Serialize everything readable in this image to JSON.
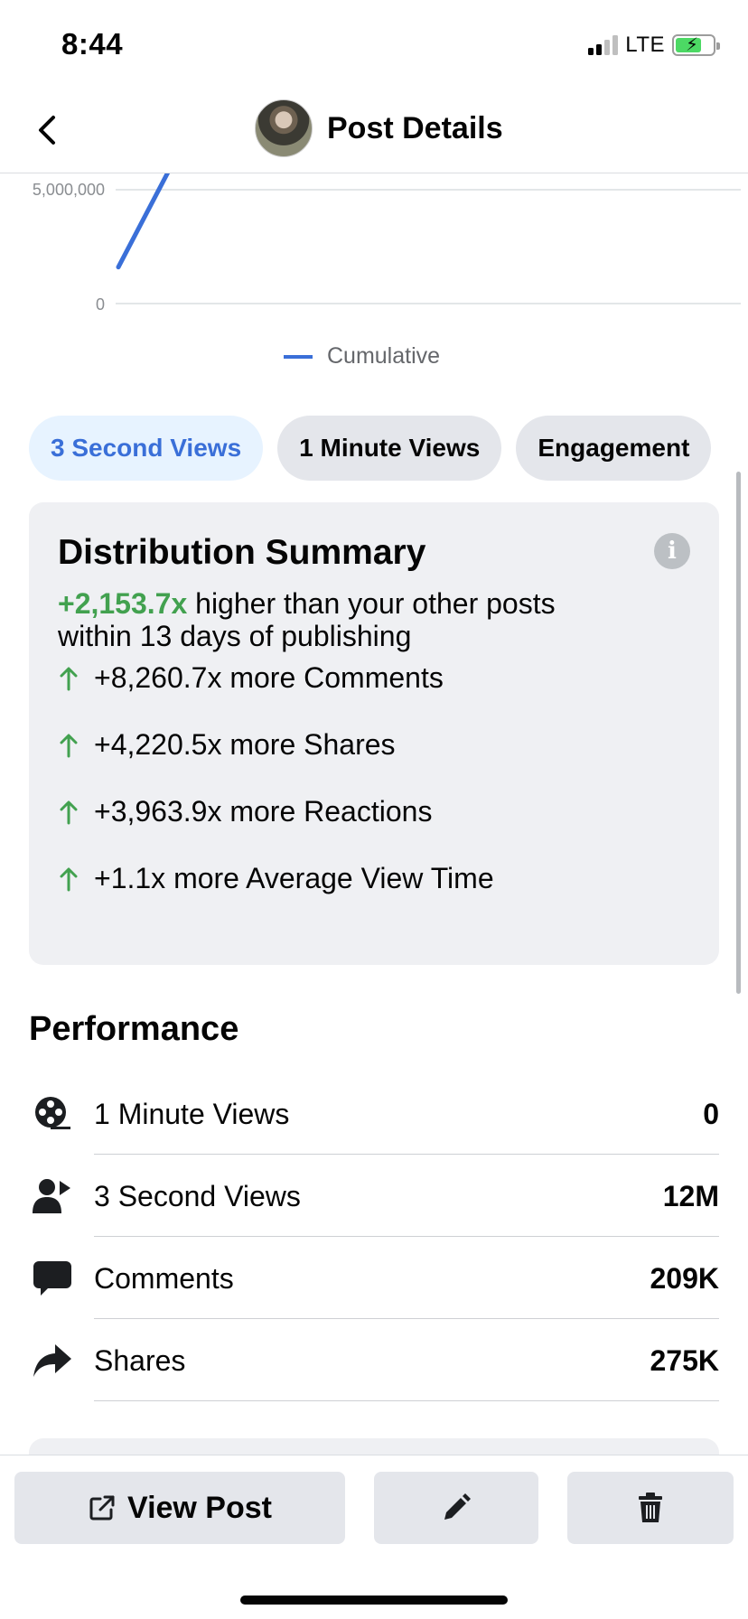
{
  "status_bar": {
    "time": "8:44",
    "network": "LTE",
    "signal_bars_active": 2,
    "signal_bars_total": 4,
    "battery_level": 0.7,
    "battery_charging": true,
    "battery_color": "#4cd964"
  },
  "header": {
    "title": "Post Details",
    "back_icon": "chevron-left-icon"
  },
  "chart_data": {
    "type": "line",
    "y_ticks": [
      "5,000,000",
      "0"
    ],
    "ylim": [
      0,
      5000000
    ],
    "series": [
      {
        "name": "Cumulative",
        "color": "#3a6fd8",
        "values": [
          1600000,
          6000000
        ]
      }
    ],
    "legend": "bottom-center"
  },
  "tabs": [
    {
      "label": "3 Second Views",
      "active": true
    },
    {
      "label": "1 Minute Views",
      "active": false
    },
    {
      "label": "Engagement",
      "active": false
    }
  ],
  "summary": {
    "title": "Distribution Summary",
    "info_icon": "info-icon",
    "highlight": "+2,153.7x",
    "lead_line1": " higher than your other posts",
    "lead_line2": "within 13 days of publishing",
    "highlight_color": "#42a14f",
    "metrics": [
      {
        "text": "+8,260.7x more Comments"
      },
      {
        "text": "+4,220.5x more Shares"
      },
      {
        "text": "+3,963.9x more Reactions"
      },
      {
        "text": "+1.1x more Average View Time"
      }
    ]
  },
  "performance": {
    "title": "Performance",
    "rows": [
      {
        "label": "1 Minute Views",
        "value": "0",
        "icon": "film-reel-icon"
      },
      {
        "label": "3 Second Views",
        "value": "12M",
        "icon": "person-play-icon"
      },
      {
        "label": "Comments",
        "value": "209K",
        "icon": "comment-bubble-icon"
      },
      {
        "label": "Shares",
        "value": "275K",
        "icon": "share-arrow-icon"
      }
    ]
  },
  "actions": {
    "view_post_label": "View Post",
    "view_post_icon": "external-link-icon",
    "edit_icon": "pencil-icon",
    "delete_icon": "trash-icon"
  },
  "colors": {
    "accent_blue": "#3a6fd8",
    "positive_green": "#42a14f",
    "card_bg": "#eff0f3",
    "button_bg": "#e4e6eb"
  }
}
